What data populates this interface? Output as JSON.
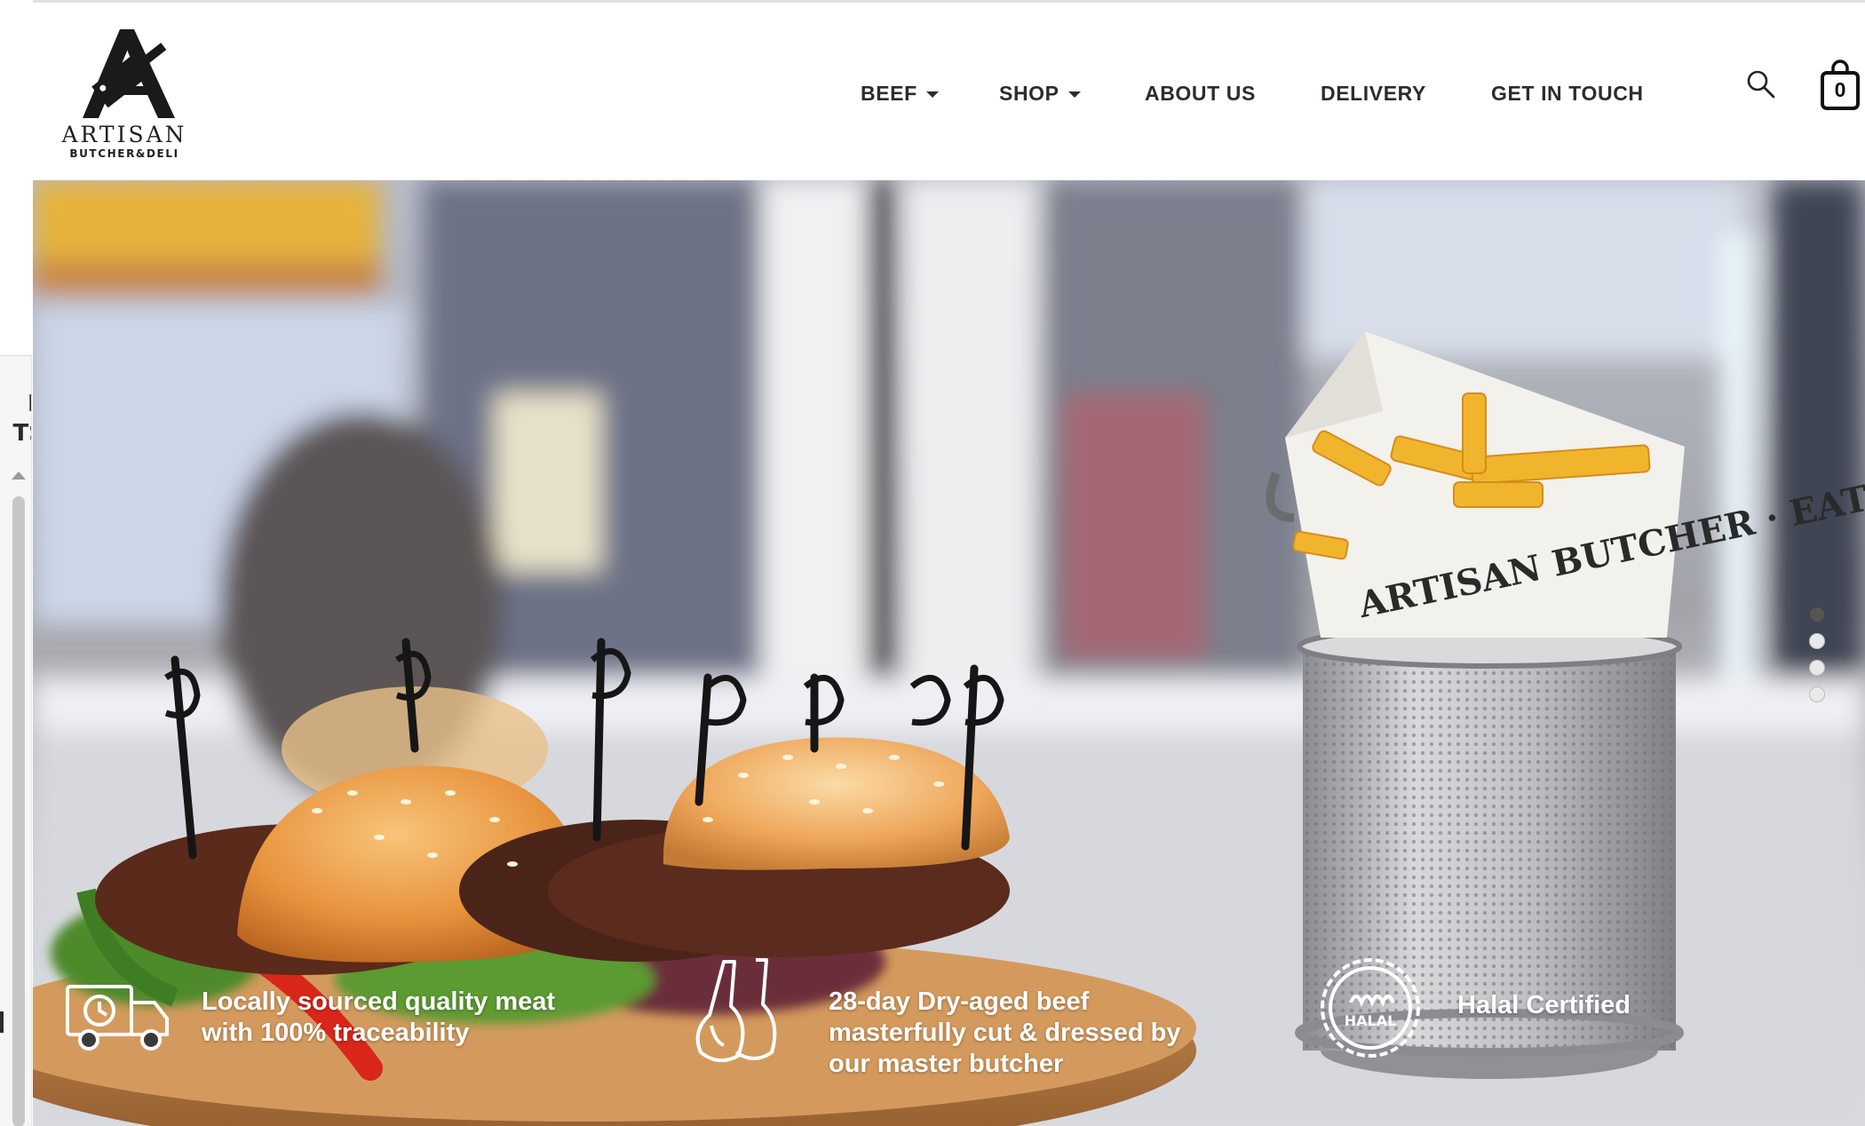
{
  "brand": {
    "name": "ARTISAN",
    "subtitle": "BUTCHER&DELI",
    "logo_icon": "crossed-cleaver-letter-a-logo"
  },
  "nav": {
    "items": [
      {
        "label": "BEEF",
        "has_dropdown": true
      },
      {
        "label": "SHOP",
        "has_dropdown": true
      },
      {
        "label": "ABOUT US",
        "has_dropdown": false
      },
      {
        "label": "DELIVERY",
        "has_dropdown": false
      },
      {
        "label": "GET IN TOUCH",
        "has_dropdown": false
      }
    ]
  },
  "header_icons": {
    "search": "search-icon",
    "cart": "shopping-bag-icon",
    "cart_count": "0"
  },
  "left_panel": {
    "clipped_text": "R\nTS"
  },
  "hero": {
    "image": "burgers-and-fries-on-wooden-board",
    "fries_wrapper_print": "ARTISAN BUTCHER · EAT",
    "slider": {
      "count": 4,
      "active_index": 0
    },
    "features": [
      {
        "icon": "delivery-truck-clock-icon",
        "lines": [
          "Locally sourced quality meat",
          "with 100% traceability"
        ]
      },
      {
        "icon": "dry-aged-beef-icon",
        "lines": [
          "28-day Dry-aged beef",
          "masterfully cut & dressed by",
          "our master butcher"
        ]
      },
      {
        "icon": "halal-badge-icon",
        "badge_text": "HALAL",
        "lines": [
          "Halal Certified"
        ]
      }
    ]
  },
  "colors": {
    "text_dark": "#2c2c2c",
    "hero_overlay_text": "#ffffff",
    "slider_dot_active": "#555555",
    "slider_dot": "#e9e9e9"
  }
}
